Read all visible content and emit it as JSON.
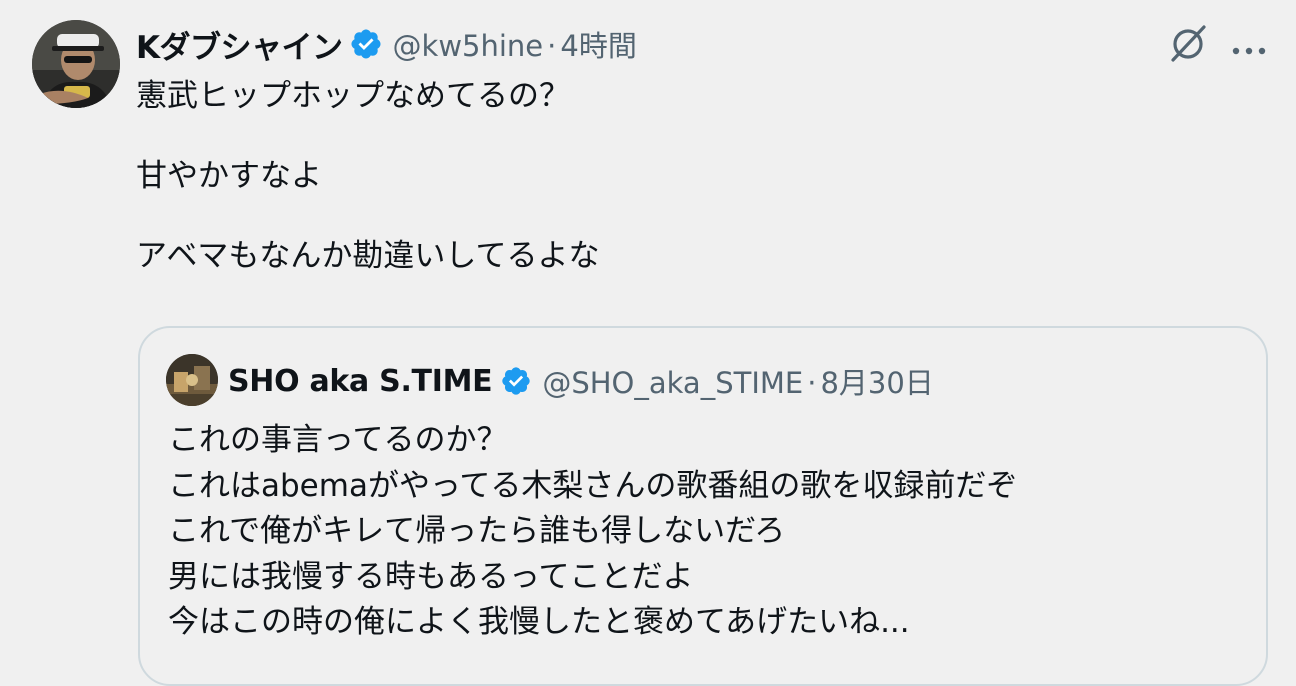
{
  "tweet": {
    "author": {
      "display_name": "Kダブシャイン",
      "handle": "@kw5hine",
      "verified": true
    },
    "separator": "·",
    "time": "4時間",
    "text": "憲武ヒップホップなめてるの？\n\n甘やかすなよ\n\nアベマもなんか勘違いしてるよな",
    "icons": {
      "grok": "grok-icon",
      "more": "more-options-icon",
      "verified": "verified-badge-icon"
    }
  },
  "quoted_tweet": {
    "author": {
      "display_name": "SHO aka S.TIME",
      "handle": "@SHO_aka_STIME",
      "verified": true
    },
    "separator": "·",
    "time": "8月30日",
    "text": "これの事言ってるのか？\nこれはabemaがやってる木梨さんの歌番組の歌を収録前だぞ\nこれで俺がキレて帰ったら誰も得しないだろ\n男には我慢する時もあるってことだよ\n今はこの時の俺によく我慢したと褒めてあげたいね..."
  },
  "colors": {
    "background": "#f0f0f0",
    "text": "#0f1419",
    "secondary_text": "#536471",
    "verified_blue": "#1d9bf0",
    "quote_border": "#cfd9de"
  }
}
